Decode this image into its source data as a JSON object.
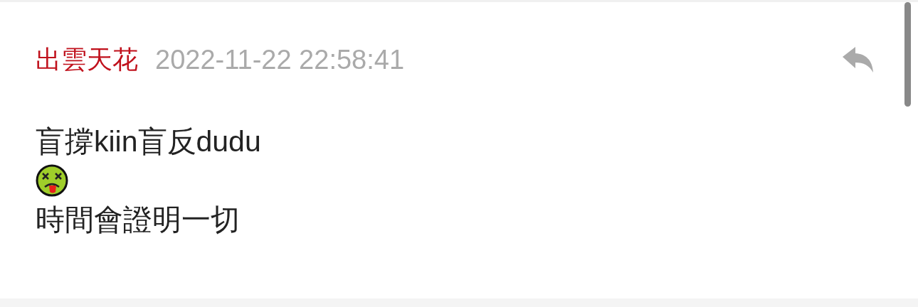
{
  "comment": {
    "author": "出雲天花",
    "time": "2022-11-22 22:58:41",
    "body": [
      {
        "kind": "text",
        "text": "盲撐kiin盲反dudu"
      },
      {
        "kind": "emoji"
      },
      {
        "kind": "text",
        "text": "時間會證明一切"
      }
    ]
  }
}
